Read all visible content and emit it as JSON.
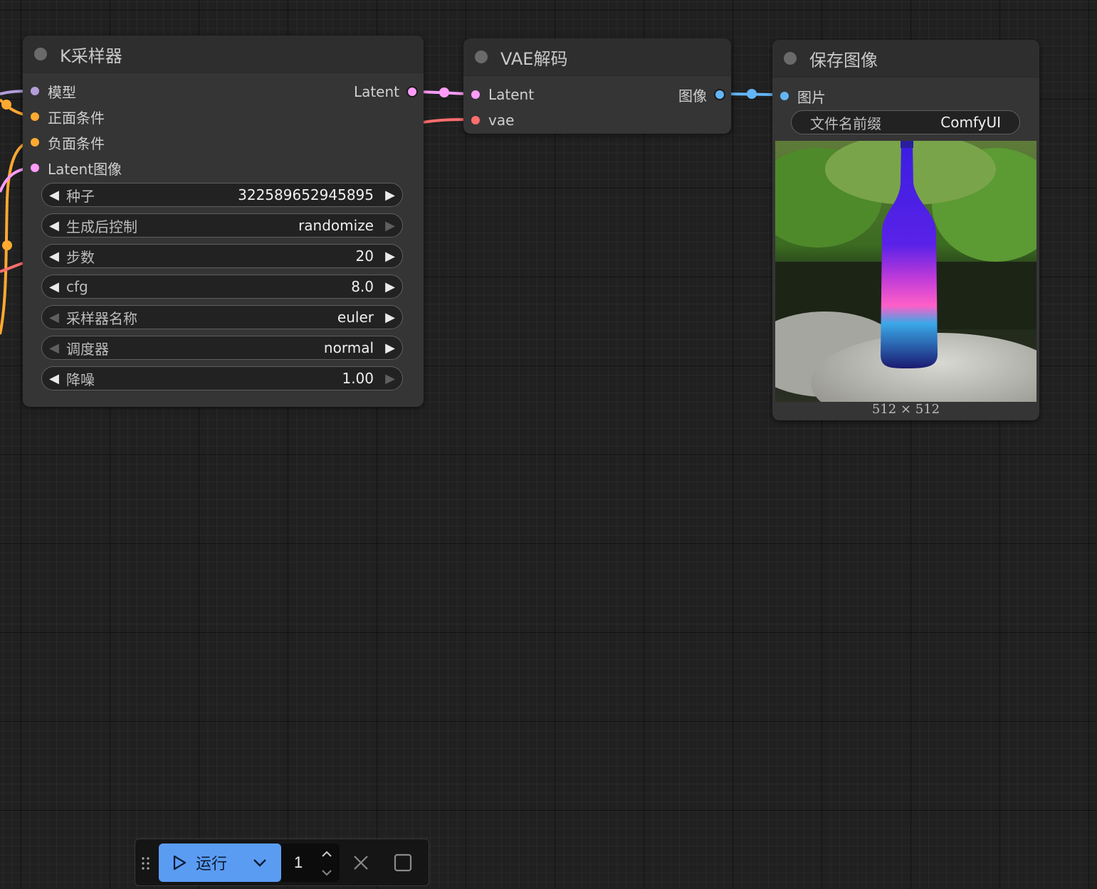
{
  "nodes": {
    "ksampler": {
      "title": "K采样器",
      "inputs": [
        {
          "label": "模型",
          "color": "#b39ddb"
        },
        {
          "label": "正面条件",
          "color": "#ffa931"
        },
        {
          "label": "负面条件",
          "color": "#ffa931"
        },
        {
          "label": "Latent图像",
          "color": "#ff9cf9"
        }
      ],
      "output": {
        "label": "Latent",
        "color": "#ff9cf9"
      },
      "widgets": [
        {
          "label": "种子",
          "value": "322589652945895"
        },
        {
          "label": "生成后控制",
          "value": "randomize"
        },
        {
          "label": "步数",
          "value": "20"
        },
        {
          "label": "cfg",
          "value": "8.0"
        },
        {
          "label": "采样器名称",
          "value": "euler"
        },
        {
          "label": "调度器",
          "value": "normal"
        },
        {
          "label": "降噪",
          "value": "1.00"
        }
      ]
    },
    "vae_decode": {
      "title": "VAE解码",
      "inputs": [
        {
          "label": "Latent",
          "color": "#ff9cf9"
        },
        {
          "label": "vae",
          "color": "#ff6e6e"
        }
      ],
      "output": {
        "label": "图像",
        "color": "#64b5f6"
      }
    },
    "save_image": {
      "title": "保存图像",
      "input": {
        "label": "图片",
        "color": "#64b5f6"
      },
      "widget": {
        "label": "文件名前缀",
        "value": "ComfyUI"
      },
      "preview_size": "512 × 512"
    }
  },
  "toolbar": {
    "run_label": "运行",
    "batch_count": "1"
  }
}
